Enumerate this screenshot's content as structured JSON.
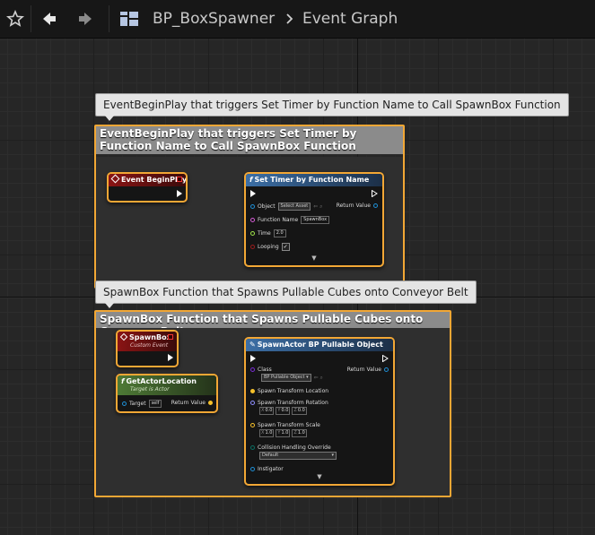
{
  "toolbar": {
    "favorite_icon": "star-icon",
    "back_icon": "arrow-left-icon",
    "forward_icon": "arrow-right-icon",
    "asset_icon": "blueprint-grid-icon",
    "asset_name": "BP_BoxSpawner",
    "separator": ">",
    "graph_name": "Event Graph"
  },
  "comments": {
    "begin_play": "EventBeginPlay that triggers Set Timer by Function Name to Call SpawnBox Function",
    "spawn_box": "SpawnBox Function that Spawns Pullable Cubes onto Conveyor Belt"
  },
  "nodes": {
    "event_begin_play": {
      "title": "Event BeginPlay"
    },
    "set_timer": {
      "title": "Set Timer by Function Name",
      "object_label": "Object",
      "object_value": "Select Asset",
      "return_label": "Return Value",
      "function_name_label": "Function Name",
      "function_name_value": "SpawnBox",
      "time_label": "Time",
      "time_value": "2.0",
      "looping_label": "Looping",
      "looping_value": "✓"
    },
    "spawn_box_event": {
      "title": "SpawnBox",
      "subtitle": "Custom Event"
    },
    "get_actor_location": {
      "title": "GetActorLocation",
      "subtitle": "Target is Actor",
      "target_label": "Target",
      "target_value": "self",
      "return_label": "Return Value"
    },
    "spawn_actor": {
      "title": "SpawnActor BP Pullable Object",
      "class_label": "Class",
      "class_value": "BP Pullable Object",
      "return_label": "Return Value",
      "transform_location_label": "Spawn Transform Location",
      "transform_rotation_label": "Spawn Transform Rotation",
      "rotation_x": "0.0",
      "rotation_y": "0.0",
      "rotation_z": "0.0",
      "transform_scale_label": "Spawn Transform Scale",
      "scale_x": "1.0",
      "scale_y": "1.0",
      "scale_z": "1.0",
      "collision_label": "Collision Handling Override",
      "collision_value": "Default",
      "instigator_label": "Instigator"
    }
  },
  "vector_axes": {
    "x": "X",
    "y": "Y",
    "z": "Z"
  },
  "colors": {
    "selection_outline": "#f2a735",
    "exec_wire": "#ffffff",
    "vector_pin": "#f5c02b",
    "object_pin": "#1e8fd6",
    "class_pin": "#7a2bd6",
    "name_pin": "#d65cd6",
    "float_pin": "#9ee24a",
    "bool_pin": "#9a1c1c",
    "transform_pin": "#e88d1f",
    "byte_pin": "#0a6e62"
  }
}
